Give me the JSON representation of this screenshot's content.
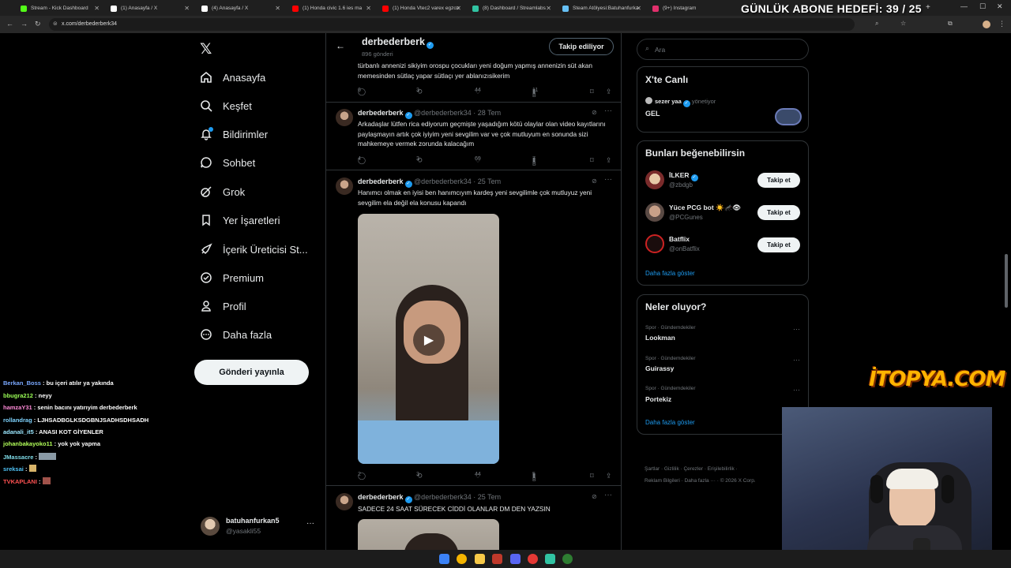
{
  "browser": {
    "tabs": [
      {
        "title": "Stream - Kick Dashboard",
        "color": "#53fc18"
      },
      {
        "title": "(1) Anasayfa / X",
        "color": "#ffffff"
      },
      {
        "title": "(4) Anasayfa / X",
        "color": "#ffffff"
      },
      {
        "title": "(1) Honda civic 1.6 ies ma",
        "color": "#ff0000"
      },
      {
        "title": "(1) Honda Vtec2 varex egzoz",
        "color": "#ff0000"
      },
      {
        "title": "(8) Dashboard / Streamlabs",
        "color": "#31c3a2"
      },
      {
        "title": "Steam Atölyesi:Batuhanfurka",
        "color": "#66c0f4"
      },
      {
        "title": "(9+) Instagram",
        "color": "#e1306c"
      }
    ],
    "url": "x.com/derbederberk34"
  },
  "overlay": {
    "subscriber_goal": "GÜNLÜK ABONE HEDEFİ: 39 / 25",
    "sponsor": "İTOPYA.COM"
  },
  "nav": {
    "items": [
      "Anasayfa",
      "Keşfet",
      "Bildirimler",
      "Sohbet",
      "Grok",
      "Yer İşaretleri",
      "İçerik Üreticisi St...",
      "Premium",
      "Profil",
      "Daha fazla"
    ],
    "post_button": "Gönderi yayınla",
    "account_name": "batuhanfurkan5",
    "account_handle": "@yasakli55"
  },
  "profile_header": {
    "name": "derbederberk",
    "posts": "896 gönderi",
    "follow_state": "Takip ediliyor"
  },
  "tweets": [
    {
      "text": "türbanlı annenizi sikiyim orospu çocukları yeni doğum yapmış annenizin süt akan memesinden sütlaç yapar sütlaçı yer ablanızısikerim",
      "replies": "6",
      "reposts": "3",
      "likes": "44",
      "views": "11 B"
    },
    {
      "name": "derbederberk",
      "handle": "@derbederberk34",
      "date": "· 28 Tem",
      "text": "Arkadaşlar lütfen rica ediyorum geçmişte yaşadığım kötü olaylar olan video kayıtlarını paylaşmayın artık çok iyiyim yeni sevgilim var ve çok mutluyum en sonunda sizi mahkemeye vermek zorunda kalacağım",
      "replies": "4",
      "reposts": "3",
      "likes": "69",
      "views": "7 B"
    },
    {
      "name": "derbederberk",
      "handle": "@derbederberk34",
      "date": "· 25 Tem",
      "text": "Hanımcı olmak en iyisi ben hanımcıyım kardeş yeni sevgilimle çok mutluyuz yeni sevgilim ela değil ela konusu kapandı",
      "replies": "2",
      "reposts": "3",
      "likes": "44",
      "views": "5 B"
    },
    {
      "name": "derbederberk",
      "handle": "@derbederberk34",
      "date": "· 25 Tem",
      "text": "SADECE 24 SAAT SÜRECEK CİDDİ OLANLAR DM DEN YAZSIN"
    }
  ],
  "search": {
    "placeholder": "Ara"
  },
  "live": {
    "title": "X'te Canlı",
    "host": "sezer yaa",
    "role": "yönetiyor",
    "space_title": "GEL"
  },
  "suggestions": {
    "title": "Bunları beğenebilirsin",
    "follow_label": "Takip et",
    "users": [
      {
        "name": "İLKER",
        "handle": "@zbdgb"
      },
      {
        "name": "Yüce PCG bot ☀️🦟👁",
        "handle": "@PCGunes"
      },
      {
        "name": "Batflix",
        "handle": "@onBatflix"
      }
    ],
    "show_more": "Daha fazla göster"
  },
  "trends": {
    "title": "Neler oluyor?",
    "items": [
      {
        "category": "Spor · Gündemdekiler",
        "name": "Lookman"
      },
      {
        "category": "Spor · Gündemdekiler",
        "name": "Guirassy"
      },
      {
        "category": "Spor · Gündemdekiler",
        "name": "Portekiz"
      }
    ],
    "show_more": "Daha fazla göster"
  },
  "footer": {
    "line1": "Şartlar  ·  Gizlilik  ·  Çerezler  ·  Erişilebilirlik  ·",
    "line2": "Reklam Bilgileri  ·  Daha fazla ···  ·  © 2026 X Corp."
  },
  "chat": [
    {
      "user": "Berkan_Boss",
      "msg": ": bu içeri atılır ya yakında",
      "color": "#7aa8ff"
    },
    {
      "user": "bbugra212",
      "msg": ": neyy",
      "color": "#9cff57"
    },
    {
      "user": "hamzaY31",
      "msg": ": senin bacını yatırıyim derbederberk",
      "color": "#ff8ad8"
    },
    {
      "user": "rollandrag",
      "msg": ": LJHSADBGLKSDGBNJSADHSDHSADH",
      "color": "#7fd4ff"
    },
    {
      "user": "adanali_it5",
      "msg": ": ANASI KOT GİYENLER",
      "color": "#9be7ff"
    },
    {
      "user": "johanbakayoko11",
      "msg": ": yok yok yapma",
      "color": "#b2ff59"
    },
    {
      "user": "JMassacre",
      "msg": ":",
      "color": "#80deea"
    },
    {
      "user": "sreksai",
      "msg": ":",
      "color": "#4fc3f7"
    },
    {
      "user": "TVKAPLANI",
      "msg": ":",
      "color": "#ff5252"
    }
  ]
}
